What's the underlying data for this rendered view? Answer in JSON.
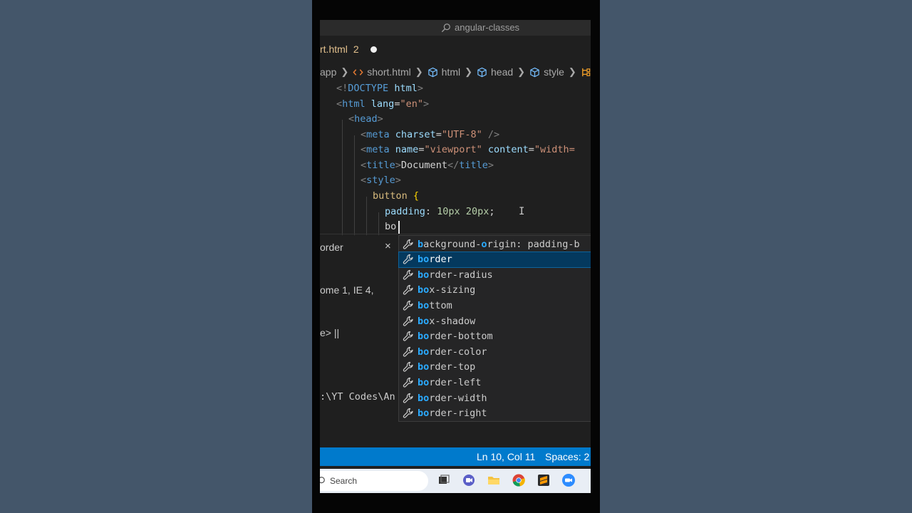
{
  "window": {
    "title": "angular-classes"
  },
  "tab": {
    "filename": "rt.html",
    "problems_count": "2"
  },
  "breadcrumb": {
    "items": [
      "app",
      "short.html",
      "html",
      "head",
      "style"
    ]
  },
  "code": {
    "line1": {
      "lt": "<!",
      "tag": "DOCTYPE",
      "sp": " ",
      "attr": "html",
      "gt": ">"
    },
    "line2": {
      "lt": "<",
      "tag": "html",
      "sp": " ",
      "attr": "lang",
      "eq": "=",
      "str": "\"en\"",
      "gt": ">"
    },
    "line3": {
      "lt": "<",
      "tag": "head",
      "gt": ">"
    },
    "line4": {
      "lt": "<",
      "tag": "meta",
      "sp": " ",
      "attr": "charset",
      "eq": "=",
      "str": "\"UTF-8\"",
      "end": " />"
    },
    "line5": {
      "lt": "<",
      "tag": "meta",
      "sp": " ",
      "attr": "name",
      "eq": "=",
      "str": "\"viewport\"",
      "sp2": " ",
      "attr2": "content",
      "eq2": "=",
      "str2": "\"width="
    },
    "line6": {
      "lt": "<",
      "tag": "title",
      "gt": ">",
      "text": "Document",
      "lt2": "</",
      "tag2": "title",
      "gt2": ">"
    },
    "line7": {
      "lt": "<",
      "tag": "style",
      "gt": ">"
    },
    "line8": {
      "selector": "button",
      "sp": " ",
      "brace": "{"
    },
    "line9": {
      "prop": "padding",
      "colon": ": ",
      "val": "10px 20px",
      "semi": ";"
    },
    "line10": {
      "typed": "bo"
    }
  },
  "hover_doc": {
    "title": "order",
    "close": "×",
    "compat": "ome 1, IE 4,",
    "syntax": "e> ||",
    "terminal_path": ":\\YT Codes\\An"
  },
  "suggestions": [
    {
      "match1": "b",
      "pre": "",
      "mid": "ackground-",
      "match2": "o",
      "rest": "rigin: padding-b",
      "active": false
    },
    {
      "match1": "bo",
      "rest": "rder",
      "active": true
    },
    {
      "match1": "bo",
      "rest": "rder-radius",
      "active": false
    },
    {
      "match1": "bo",
      "rest": "x-sizing",
      "active": false
    },
    {
      "match1": "bo",
      "rest": "ttom",
      "active": false
    },
    {
      "match1": "bo",
      "rest": "x-shadow",
      "active": false
    },
    {
      "match1": "bo",
      "rest": "rder-bottom",
      "active": false
    },
    {
      "match1": "bo",
      "rest": "rder-color",
      "active": false
    },
    {
      "match1": "bo",
      "rest": "rder-top",
      "active": false
    },
    {
      "match1": "bo",
      "rest": "rder-left",
      "active": false
    },
    {
      "match1": "bo",
      "rest": "rder-width",
      "active": false
    },
    {
      "match1": "bo",
      "rest": "rder-right",
      "active": false
    }
  ],
  "statusbar": {
    "position": "Ln 10, Col 11",
    "spaces": "Spaces: 2"
  },
  "taskbar": {
    "search_placeholder": "Search",
    "icons": [
      "task-view-icon",
      "chat-icon",
      "file-explorer-icon",
      "chrome-icon",
      "sublime-icon",
      "zoom-icon"
    ]
  },
  "colors": {
    "status_bar": "#007acc",
    "suggest_active": "#04395e",
    "match_highlight": "#2aaaff",
    "background": "#45576a"
  }
}
